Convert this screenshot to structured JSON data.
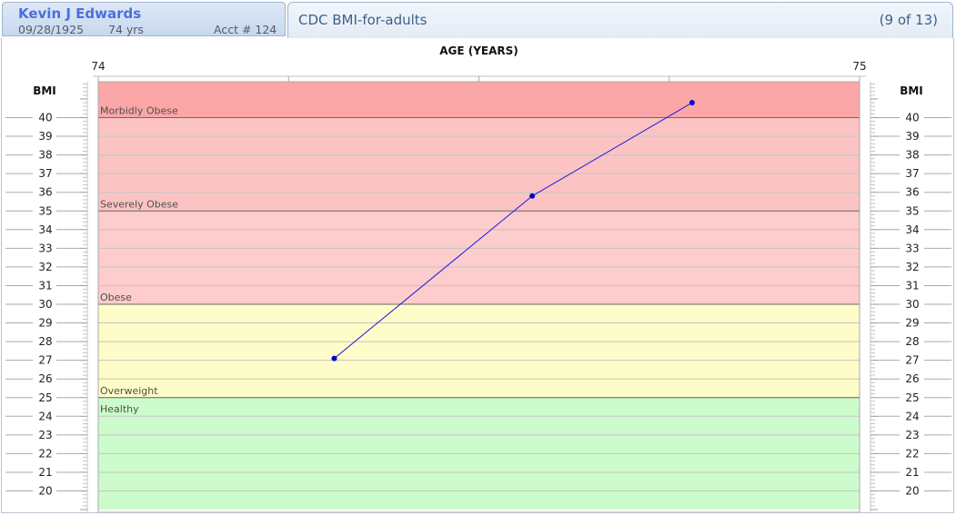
{
  "patient": {
    "name": "Kevin J Edwards",
    "dob": "09/28/1925",
    "age": "74 yrs",
    "acct": "Acct # 124"
  },
  "chart_tab": {
    "title": "CDC BMI-for-adults",
    "position": "(9 of 13)"
  },
  "colors": {
    "morbidly_obese": "#fba7a7",
    "severely_obese": "#fcc3c3",
    "obese_to_severe": "#fdcccc",
    "overweight": "#fefcc8",
    "healthy": "#ccfccc",
    "line": "#1a1ae0",
    "point": "#0000cc"
  },
  "chart_data": {
    "type": "line",
    "title": "",
    "xlabel": "AGE (YEARS)",
    "ylabel": "BMI",
    "xlim": [
      74,
      75
    ],
    "ylim": [
      19.0,
      42.0
    ],
    "x_tick_labels": [
      "74",
      "75"
    ],
    "y_ticks": [
      20,
      21,
      22,
      23,
      24,
      25,
      26,
      27,
      28,
      29,
      30,
      31,
      32,
      33,
      34,
      35,
      36,
      37,
      38,
      39,
      40
    ],
    "grid": true,
    "zones": [
      {
        "label": "Healthy",
        "from": 19.0,
        "to": 25
      },
      {
        "label": "Overweight",
        "from": 25,
        "to": 30
      },
      {
        "label": "Obese",
        "from": 30,
        "to": 35
      },
      {
        "label": "Severely Obese",
        "from": 35,
        "to": 40
      },
      {
        "label": "Morbidly Obese",
        "from": 40,
        "to": 42.0
      }
    ],
    "series": [
      {
        "x": [
          74.31,
          74.57,
          74.78
        ],
        "y": [
          27.1,
          35.8,
          40.8
        ]
      }
    ]
  }
}
